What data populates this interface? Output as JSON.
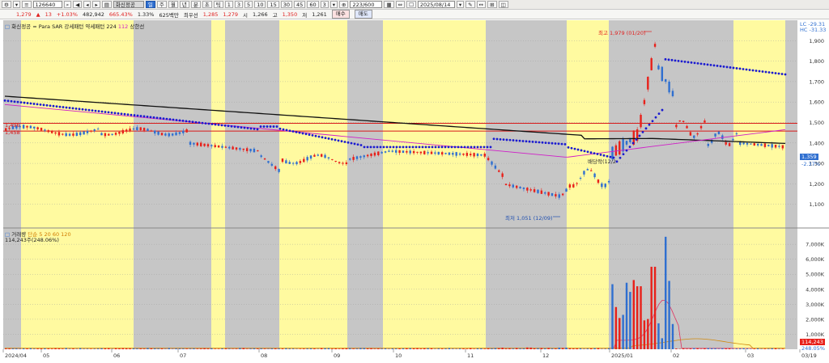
{
  "toolbar": {
    "code": "126640",
    "name": "화신정공",
    "periods": [
      "주",
      "월",
      "년",
      "분",
      "초",
      "틱"
    ],
    "intervals": [
      "1",
      "3",
      "5",
      "10",
      "15",
      "30",
      "45",
      "60",
      "3"
    ],
    "count": "223/600",
    "date": "2025/08/14"
  },
  "quote": {
    "price": "1,279",
    "change": "13",
    "change_pct": "+1.03%",
    "volume": "482,942",
    "volume_ratio": "665.43%",
    "turnover_pct": "1.33%",
    "amount": "625백만",
    "label_cheuseon": "최우선",
    "bid1": "1,285",
    "bid2": "1,279",
    "label_open": "시",
    "open": "1,266",
    "label_high": "고",
    "high": "1,350",
    "label_low": "저",
    "low": "1,261",
    "buy_label": "매수",
    "sell_label": "매도"
  },
  "main_pane": {
    "legend_name": "화신정공",
    "legend_indicator": "= Para SAR 강세패턴 약세패턴",
    "legend_ma": "224",
    "legend_ma2": "112",
    "legend_upper": "상한선",
    "lc": "LC -29.31",
    "hc": "HC -31.33",
    "high_annot": "최고 1,979 (01/20)",
    "low_annot": "최저 1,051 (12/09)",
    "dividend_annot": "배당락(12/2",
    "hline1": "1,496",
    "hline2": "1,458",
    "cur_price": "1,359",
    "cur_pct": "-2.37%"
  },
  "vol_pane": {
    "legend_name": "거래량",
    "legend_ma": "단순 5  20  60  120",
    "legend_value": "114,243주(248.06%)",
    "cur_vol": "114,243",
    "cur_vol_pct": "248.05%"
  },
  "price_axis": [
    "1,900",
    "1,800",
    "1,700",
    "1,600",
    "1,500",
    "1,400",
    "1,300",
    "1,200",
    "1,100"
  ],
  "volume_axis": [
    "7,000K",
    "6,000K",
    "5,000K",
    "4,000K",
    "3,000K",
    "2,000K",
    "1,000K"
  ],
  "date_axis": [
    "2024/04",
    "05",
    "06",
    "07",
    "08",
    "09",
    "10",
    "11",
    "12",
    "2025/01",
    "02",
    "03",
    "03/19"
  ],
  "colors": {
    "up": "#e8201a",
    "down": "#2f6fd0",
    "sar": "#1a1ad0",
    "ma_long": "#111111",
    "ma_mid": "#d020c8",
    "hline": "#d81818",
    "band_yellow": "#fffaa0",
    "band_gray": "#c6c6c6"
  }
}
